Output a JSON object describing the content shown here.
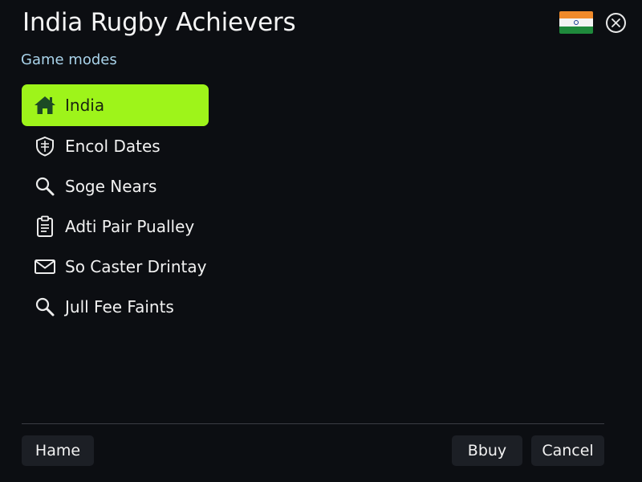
{
  "window": {
    "title": "India Rugby Achievers",
    "flag_icon": "india-flag",
    "close_icon": "close-icon"
  },
  "section": {
    "label": "Game modes"
  },
  "menu": {
    "items": [
      {
        "label": "India",
        "icon": "home-icon",
        "active": true
      },
      {
        "label": "Encol Dates",
        "icon": "shield-icon",
        "active": false
      },
      {
        "label": "Soge Nears",
        "icon": "search-icon",
        "active": false
      },
      {
        "label": "Adti Pair Pualley",
        "icon": "clipboard-icon",
        "active": false
      },
      {
        "label": "So Caster Drintay",
        "icon": "mail-icon",
        "active": false
      },
      {
        "label": "Jull Fee Faints",
        "icon": "search-icon",
        "active": false
      }
    ]
  },
  "footer": {
    "home_label": "Hame",
    "buy_label": "Bbuy",
    "cancel_label": "Cancel"
  },
  "colors": {
    "background": "#0c0e12",
    "accent": "#9ef41a",
    "section_label": "#a9d3ea",
    "button_bg": "#1c1f25"
  }
}
